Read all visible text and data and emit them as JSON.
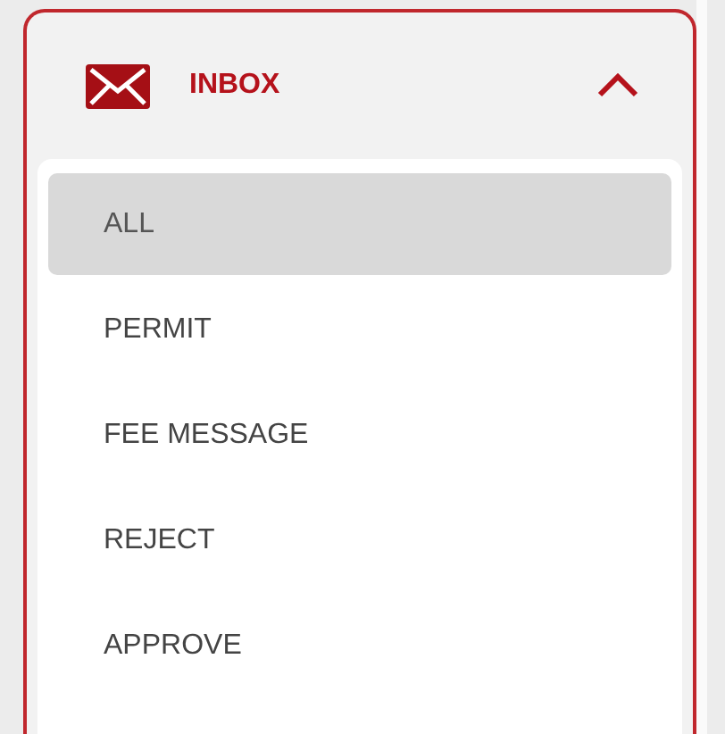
{
  "menu": {
    "title": "INBOX",
    "expanded": true,
    "items": [
      {
        "label": "ALL",
        "selected": true
      },
      {
        "label": "PERMIT",
        "selected": false
      },
      {
        "label": "FEE MESSAGE",
        "selected": false
      },
      {
        "label": "REJECT",
        "selected": false
      },
      {
        "label": "APPROVE",
        "selected": false
      }
    ]
  }
}
